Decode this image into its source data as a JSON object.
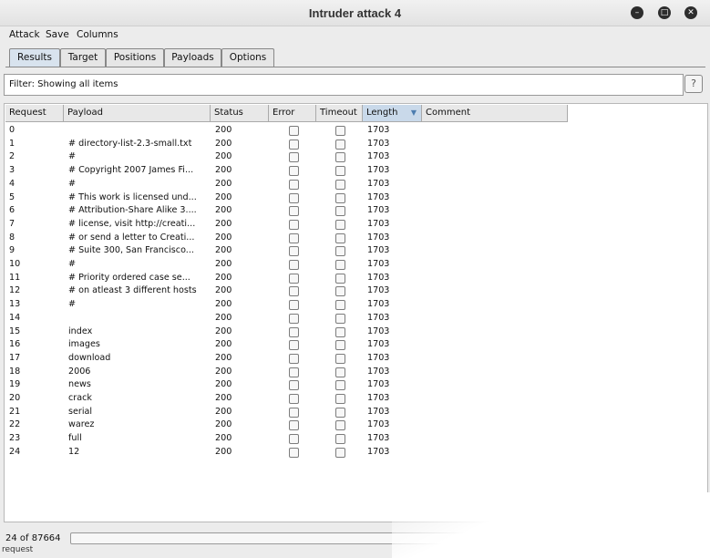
{
  "window": {
    "title": "Intruder attack 4"
  },
  "menu": [
    "Attack",
    "Save",
    "Columns"
  ],
  "tabs": [
    "Results",
    "Target",
    "Positions",
    "Payloads",
    "Options"
  ],
  "filter": {
    "text": "Filter:  Showing all items",
    "help_label": "?"
  },
  "table": {
    "columns": [
      "Request",
      "Payload",
      "Status",
      "Error",
      "Timeout",
      "Length",
      "Comment"
    ],
    "sorted_column": "Length",
    "rows": [
      {
        "request": "0",
        "payload": "",
        "status": "200",
        "error": false,
        "timeout": false,
        "length": "1703"
      },
      {
        "request": "1",
        "payload": "# directory-list-2.3-small.txt",
        "status": "200",
        "error": false,
        "timeout": false,
        "length": "1703"
      },
      {
        "request": "2",
        "payload": "#",
        "status": "200",
        "error": false,
        "timeout": false,
        "length": "1703"
      },
      {
        "request": "3",
        "payload": "# Copyright 2007 James Fi...",
        "status": "200",
        "error": false,
        "timeout": false,
        "length": "1703"
      },
      {
        "request": "4",
        "payload": "#",
        "status": "200",
        "error": false,
        "timeout": false,
        "length": "1703"
      },
      {
        "request": "5",
        "payload": "# This work is licensed und...",
        "status": "200",
        "error": false,
        "timeout": false,
        "length": "1703"
      },
      {
        "request": "6",
        "payload": "# Attribution-Share Alike 3....",
        "status": "200",
        "error": false,
        "timeout": false,
        "length": "1703"
      },
      {
        "request": "7",
        "payload": "# license, visit http://creati...",
        "status": "200",
        "error": false,
        "timeout": false,
        "length": "1703"
      },
      {
        "request": "8",
        "payload": "# or send a letter to Creati...",
        "status": "200",
        "error": false,
        "timeout": false,
        "length": "1703"
      },
      {
        "request": "9",
        "payload": "# Suite 300, San Francisco...",
        "status": "200",
        "error": false,
        "timeout": false,
        "length": "1703"
      },
      {
        "request": "10",
        "payload": "#",
        "status": "200",
        "error": false,
        "timeout": false,
        "length": "1703"
      },
      {
        "request": "11",
        "payload": "# Priority ordered case se...",
        "status": "200",
        "error": false,
        "timeout": false,
        "length": "1703"
      },
      {
        "request": "12",
        "payload": "# on atleast 3 different hosts",
        "status": "200",
        "error": false,
        "timeout": false,
        "length": "1703"
      },
      {
        "request": "13",
        "payload": "#",
        "status": "200",
        "error": false,
        "timeout": false,
        "length": "1703"
      },
      {
        "request": "14",
        "payload": "",
        "status": "200",
        "error": false,
        "timeout": false,
        "length": "1703"
      },
      {
        "request": "15",
        "payload": "index",
        "status": "200",
        "error": false,
        "timeout": false,
        "length": "1703"
      },
      {
        "request": "16",
        "payload": "images",
        "status": "200",
        "error": false,
        "timeout": false,
        "length": "1703"
      },
      {
        "request": "17",
        "payload": "download",
        "status": "200",
        "error": false,
        "timeout": false,
        "length": "1703"
      },
      {
        "request": "18",
        "payload": "2006",
        "status": "200",
        "error": false,
        "timeout": false,
        "length": "1703"
      },
      {
        "request": "19",
        "payload": "news",
        "status": "200",
        "error": false,
        "timeout": false,
        "length": "1703"
      },
      {
        "request": "20",
        "payload": "crack",
        "status": "200",
        "error": false,
        "timeout": false,
        "length": "1703"
      },
      {
        "request": "21",
        "payload": "serial",
        "status": "200",
        "error": false,
        "timeout": false,
        "length": "1703"
      },
      {
        "request": "22",
        "payload": "warez",
        "status": "200",
        "error": false,
        "timeout": false,
        "length": "1703"
      },
      {
        "request": "23",
        "payload": "full",
        "status": "200",
        "error": false,
        "timeout": false,
        "length": "1703"
      },
      {
        "request": "24",
        "payload": "12",
        "status": "200",
        "error": false,
        "timeout": false,
        "length": "1703"
      }
    ]
  },
  "status": {
    "count": "24 of 87664",
    "under_text": "request"
  }
}
